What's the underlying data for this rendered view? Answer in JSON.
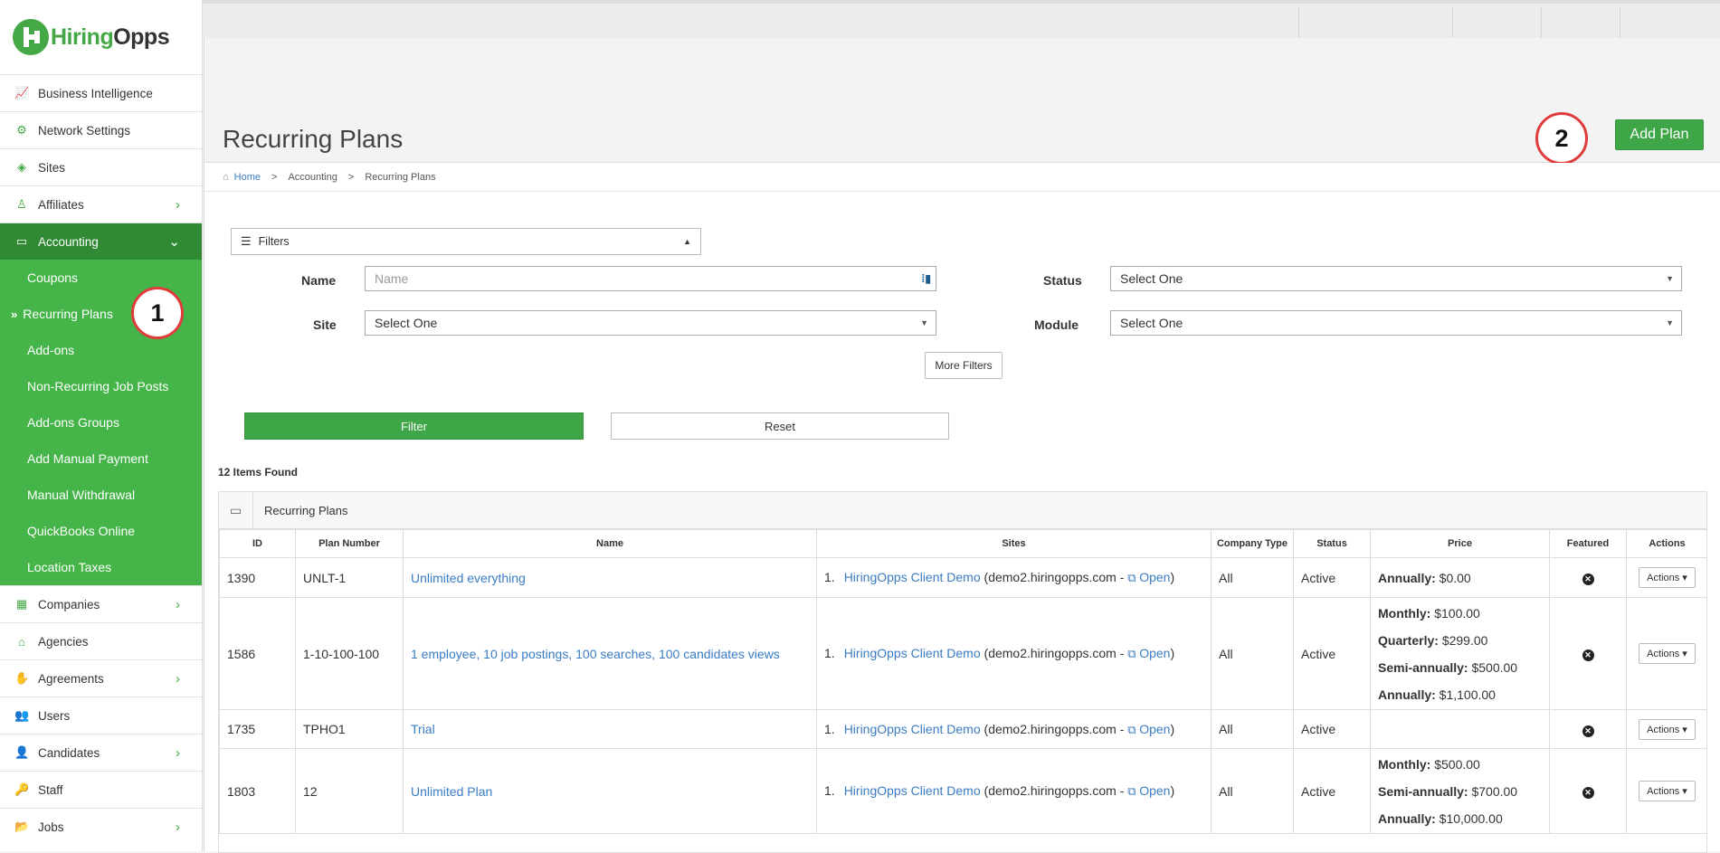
{
  "app": {
    "logo_part1": "Hiring",
    "logo_part2": "Opps"
  },
  "sidebar": {
    "items_top": [
      {
        "label": "Business Intelligence",
        "icon": "chart-line-icon",
        "glyph": "📈",
        "has_chevron": false
      },
      {
        "label": "Network Settings",
        "icon": "network-icon",
        "glyph": "⚙",
        "has_chevron": false
      },
      {
        "label": "Sites",
        "icon": "cube-icon",
        "glyph": "◈",
        "has_chevron": false
      },
      {
        "label": "Affiliates",
        "icon": "person-icon",
        "glyph": "♙",
        "has_chevron": true
      }
    ],
    "accounting": {
      "label": "Accounting",
      "icon": "credit-card-icon",
      "glyph": "▭",
      "chevron": "⌄"
    },
    "sub_items": [
      "Coupons",
      "Recurring Plans",
      "Add-ons",
      "Non-Recurring Job Posts",
      "Add-ons Groups",
      "Add Manual Payment",
      "Manual Withdrawal",
      "QuickBooks Online",
      "Location Taxes"
    ],
    "current_sub": "Recurring Plans",
    "items_bottom": [
      {
        "label": "Companies",
        "icon": "building-icon",
        "glyph": "▦",
        "has_chevron": true
      },
      {
        "label": "Agencies",
        "icon": "bank-icon",
        "glyph": "⌂",
        "has_chevron": false
      },
      {
        "label": "Agreements",
        "icon": "handshake-icon",
        "glyph": "✋",
        "has_chevron": true
      },
      {
        "label": "Users",
        "icon": "users-icon",
        "glyph": "👥",
        "has_chevron": false
      },
      {
        "label": "Candidates",
        "icon": "candidate-icon",
        "glyph": "👤",
        "has_chevron": true
      },
      {
        "label": "Staff",
        "icon": "key-icon",
        "glyph": "🔑",
        "has_chevron": false
      },
      {
        "label": "Jobs",
        "icon": "folder-icon",
        "glyph": "📂",
        "has_chevron": true
      }
    ],
    "chevron_glyph": "›"
  },
  "callouts": {
    "one": "1",
    "two": "2"
  },
  "header": {
    "title": "Recurring Plans",
    "add_button": "Add Plan"
  },
  "breadcrumb": {
    "home": "Home",
    "sep": ">",
    "section": "Accounting",
    "page": "Recurring Plans"
  },
  "filters": {
    "toggle_label": "Filters",
    "name_label": "Name",
    "name_placeholder": "Name",
    "status_label": "Status",
    "status_value": "Select One",
    "site_label": "Site",
    "site_value": "Select One",
    "module_label": "Module",
    "module_value": "Select One",
    "more_filters": "More Filters",
    "filter_button": "Filter",
    "reset_button": "Reset"
  },
  "results": {
    "count_text": "12 Items Found",
    "panel_title": "Recurring Plans"
  },
  "table": {
    "headers": [
      "ID",
      "Plan Number",
      "Name",
      "Sites",
      "Company Type",
      "Status",
      "Price",
      "Featured",
      "Actions"
    ],
    "rows": [
      {
        "id": "1390",
        "plan_number": "UNLT-1",
        "name": "Unlimited everything",
        "site_num": "1.",
        "site_name": "HiringOpps Client Demo",
        "site_domain": "(demo2.hiringopps.com - ",
        "open": "Open",
        "close": ")",
        "company_type": "All",
        "status": "Active",
        "prices": [
          {
            "label": "Annually:",
            "value": "$0.00"
          }
        ],
        "actions": "Actions ▾"
      },
      {
        "id": "1586",
        "plan_number": "1-10-100-100",
        "name": "1 employee, 10 job postings, 100 searches, 100 candidates views",
        "site_num": "1.",
        "site_name": "HiringOpps Client Demo",
        "site_domain": "(demo2.hiringopps.com - ",
        "open": "Open",
        "close": ")",
        "company_type": "All",
        "status": "Active",
        "prices": [
          {
            "label": "Monthly:",
            "value": "$100.00"
          },
          {
            "label": "Quarterly:",
            "value": "$299.00"
          },
          {
            "label": "Semi-annually:",
            "value": "$500.00"
          },
          {
            "label": "Annually:",
            "value": "$1,100.00"
          }
        ],
        "actions": "Actions ▾"
      },
      {
        "id": "1735",
        "plan_number": "TPHO1",
        "name": "Trial",
        "site_num": "1.",
        "site_name": "HiringOpps Client Demo",
        "site_domain": "(demo2.hiringopps.com - ",
        "open": "Open",
        "close": ")",
        "company_type": "All",
        "status": "Active",
        "prices": [],
        "actions": "Actions ▾"
      },
      {
        "id": "1803",
        "plan_number": "12",
        "name": "Unlimited Plan",
        "site_num": "1.",
        "site_name": "HiringOpps Client Demo",
        "site_domain": "(demo2.hiringopps.com - ",
        "open": "Open",
        "close": ")",
        "company_type": "All",
        "status": "Active",
        "prices": [
          {
            "label": "Monthly:",
            "value": "$500.00"
          },
          {
            "label": "Semi-annually:",
            "value": "$700.00"
          },
          {
            "label": "Annually:",
            "value": "$10,000.00"
          }
        ],
        "actions": "Actions ▾"
      }
    ]
  },
  "colors": {
    "brand_green": "#45b549",
    "active_dark_green": "#2f8a33",
    "link_blue": "#3a7cc4",
    "callout_red": "#e03b3b"
  }
}
